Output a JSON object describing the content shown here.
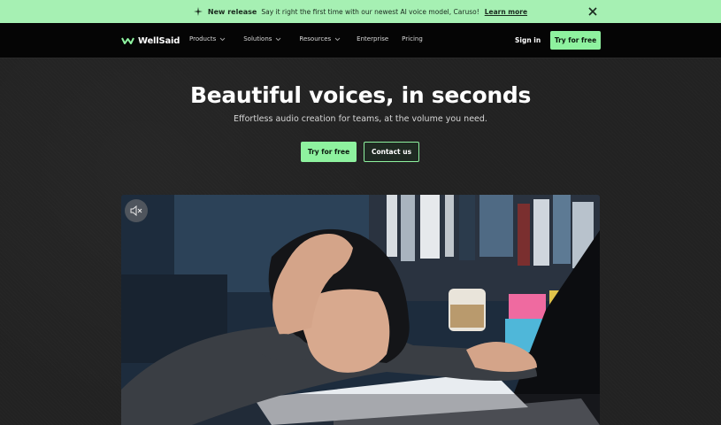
{
  "announcement": {
    "label": "New release",
    "message": "Say it right the first time with our newest AI voice model, Caruso!",
    "link": "Learn more",
    "icons": {
      "sparkle": "sparkle-icon",
      "close": "close-icon"
    }
  },
  "nav": {
    "logo_text": "WellSaid",
    "items": [
      {
        "label": "Products",
        "dropdown": true
      },
      {
        "label": "Solutions",
        "dropdown": true
      },
      {
        "label": "Resources",
        "dropdown": true
      },
      {
        "label": "Enterprise",
        "dropdown": false
      },
      {
        "label": "Pricing",
        "dropdown": false
      }
    ],
    "signin": "Sign in",
    "cta": "Try for free"
  },
  "hero": {
    "title": "Beautiful voices, in seconds",
    "subtitle": "Effortless audio creation for teams, at the volume you need.",
    "primary_cta": "Try for free",
    "secondary_cta": "Contact us"
  },
  "video": {
    "mute_icon": "volume-muted-icon"
  },
  "colors": {
    "accent": "#8ef29f",
    "banner": "#a6f0b3",
    "nav_bg": "#050505",
    "page_bg": "#222222"
  }
}
